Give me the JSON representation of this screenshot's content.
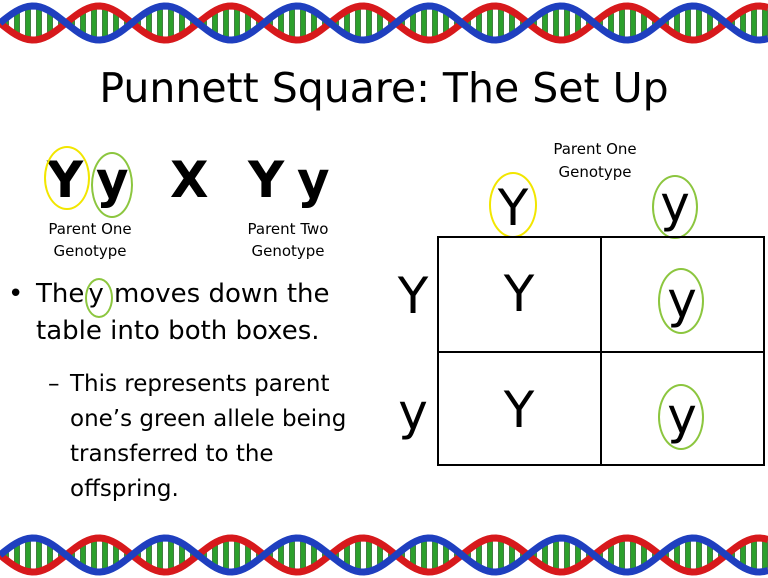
{
  "slide": {
    "title": "Punnett Square: The Set Up"
  },
  "genotypes": {
    "parent_one": {
      "allele_1": "Y",
      "allele_2": "y",
      "label_line1": "Parent One",
      "label_line2": "Genotype"
    },
    "cross_symbol": "X",
    "parent_two": {
      "allele_1": "Y",
      "allele_2": "y",
      "label_line1": "Parent Two",
      "label_line2": "Genotype"
    }
  },
  "bullets": {
    "main_before": "The",
    "main_highlight": "y",
    "main_after": " moves down the table into both boxes.",
    "sub": "This represents parent one’s green allele being transferred to the offspring."
  },
  "punnett": {
    "top_label_line1": "Parent One",
    "top_label_line2": "Genotype",
    "top_alleles": [
      "Y",
      "y"
    ],
    "side_alleles": [
      "Y",
      "y"
    ],
    "cells": [
      [
        "Y",
        "y"
      ],
      [
        "Y",
        "y"
      ]
    ]
  },
  "colors": {
    "highlight_yellow": "#f2e600",
    "highlight_green": "#8cc63f",
    "dna_red": "#d7191c",
    "dna_blue": "#1f3fbf",
    "dna_green": "#2ca02c"
  }
}
